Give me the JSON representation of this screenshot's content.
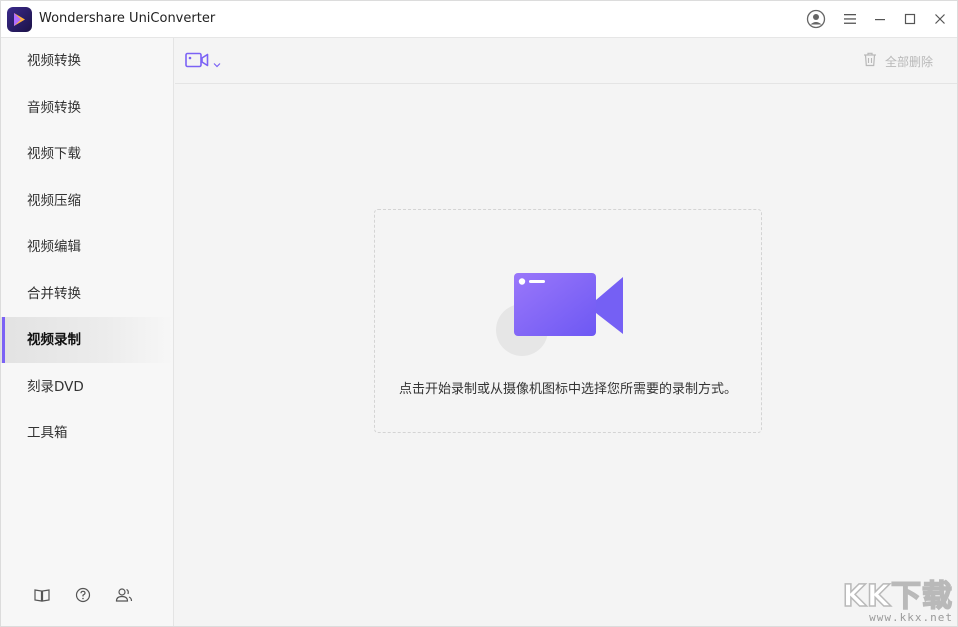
{
  "titlebar": {
    "app_name": "Wondershare UniConverter",
    "icons": [
      "account-icon",
      "menu-icon",
      "minimize-icon",
      "maximize-icon",
      "close-icon"
    ]
  },
  "sidebar": {
    "items": [
      {
        "label": "视频转换"
      },
      {
        "label": "音频转换"
      },
      {
        "label": "视频下载"
      },
      {
        "label": "视频压缩"
      },
      {
        "label": "视频编辑"
      },
      {
        "label": "合并转换"
      },
      {
        "label": "视频录制",
        "active": true
      },
      {
        "label": "刻录DVD"
      },
      {
        "label": "工具箱"
      }
    ],
    "bottom_icons": [
      "guide-book-icon",
      "help-icon",
      "account-switch-icon"
    ]
  },
  "toolbar": {
    "record_icon": "video-camera-icon",
    "delete_all_label": "全部删除"
  },
  "main": {
    "hint_text": "点击开始录制或从摄像机图标中选择您所需要的录制方式。"
  },
  "watermark": {
    "brand": "KK下载",
    "url": "www.kkx.net"
  },
  "colors": {
    "accent": "#7b62f5",
    "camera_gradient_start": "#8d6cf8",
    "camera_gradient_end": "#6d58f3"
  }
}
